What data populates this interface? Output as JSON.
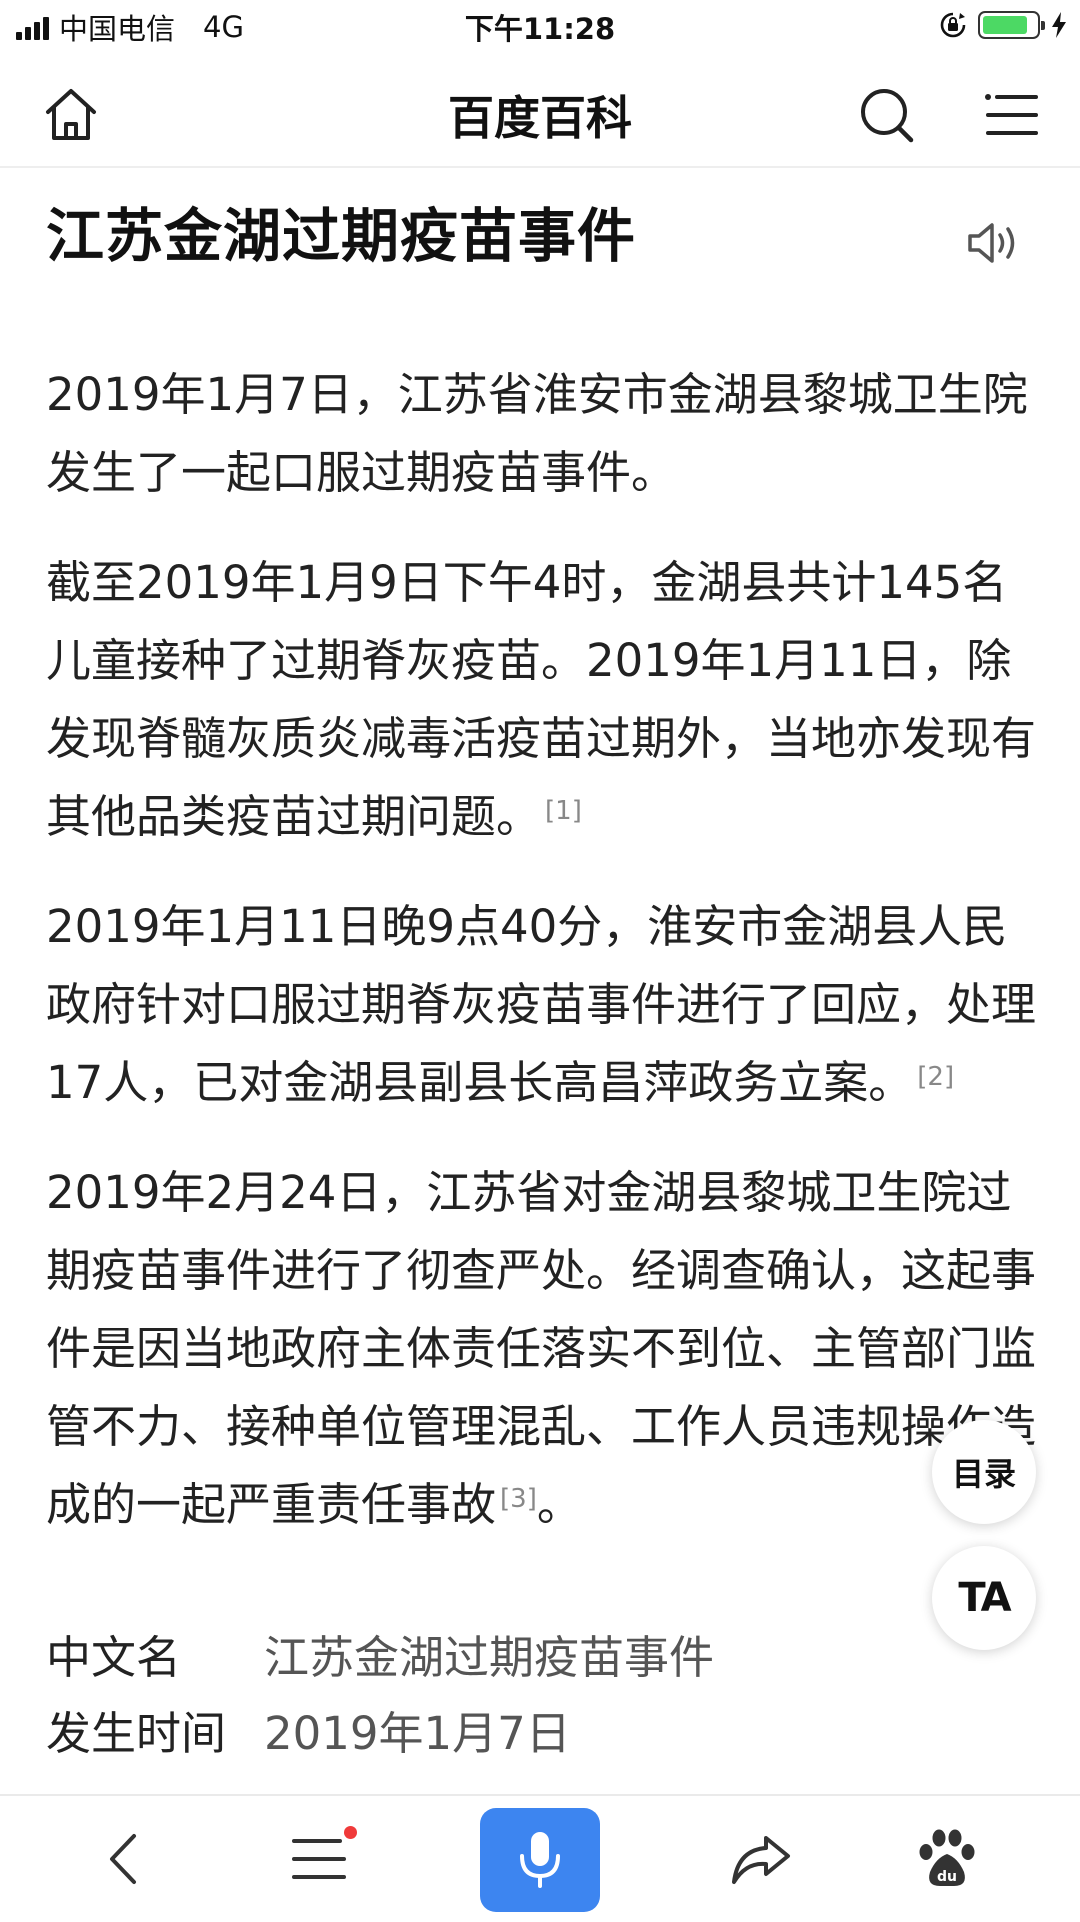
{
  "status_bar": {
    "carrier": "中国电信",
    "network": "4G",
    "time": "下午11:28",
    "battery_level": 0.85,
    "battery_color": "#4cd964"
  },
  "header": {
    "title": "百度百科",
    "left_icon": "home-icon",
    "right_icons": [
      "search-icon",
      "menu-icon"
    ]
  },
  "article": {
    "title": "江苏金湖过期疫苗事件",
    "speaker_icon": "speaker-icon",
    "paragraphs": [
      {
        "text": "2019年1月7日，江苏省淮安市金湖县黎城卫生院发生了一起口服过期疫苗事件。",
        "tail": "",
        "ref": ""
      },
      {
        "text": "截至2019年1月9日下午4时，金湖县共计145名儿童接种了过期脊灰疫苗。2019年1月11日，除发现脊髓灰质炎减毒活疫苗过期外，当地亦发现有其他品类疫苗过期问题。",
        "tail": "",
        "ref": "[1]"
      },
      {
        "text": "2019年1月11日晚9点40分，淮安市金湖县人民政府针对口服过期脊灰疫苗事件进行了回应，处理17人，已对金湖县副县长高昌萍政务立案。",
        "tail": "",
        "ref": "[2]"
      },
      {
        "text": "2019年2月24日，江苏省对金湖县黎城卫生院过期疫苗事件进行了彻查严处。经调查确认，这起事件是因当地政府主体责任落实不到位、主管部门监管不力、接种单位管理混乱、工作人员违规操作造成的一起严重责任事故",
        "tail": "。",
        "ref": "[3]"
      }
    ]
  },
  "infobox": [
    {
      "label": "中文名",
      "value": "江苏金湖过期疫苗事件"
    },
    {
      "label": "发生时间",
      "value": "2019年1月7日"
    }
  ],
  "floating": {
    "toc_label": "目录",
    "ta_label": "TA"
  },
  "bottom_bar": {
    "icons": [
      "back-icon",
      "list-icon",
      "mic-icon",
      "share-icon",
      "baidu-paw-icon"
    ],
    "paw_text": "du",
    "accent": "#3d85f0",
    "notification_color": "#f03a3a"
  }
}
